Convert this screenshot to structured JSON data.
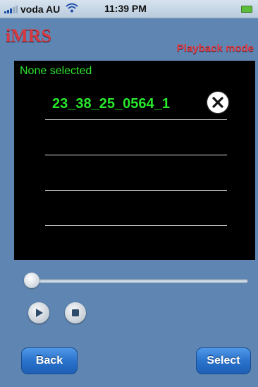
{
  "status_bar": {
    "carrier": "voda AU",
    "time": "11:39 PM"
  },
  "header": {
    "app_title": "iMRS",
    "mode": "Playback mode"
  },
  "list": {
    "selection_status": "None selected",
    "items": [
      {
        "label": "23_38_25_0564_1",
        "removable": true
      },
      {
        "label": "",
        "removable": false
      },
      {
        "label": "",
        "removable": false
      },
      {
        "label": "",
        "removable": false
      }
    ]
  },
  "playback": {
    "position_fraction": 0.0
  },
  "footer": {
    "back_label": "Back",
    "select_label": "Select"
  },
  "colors": {
    "background": "#5f86b2",
    "list_text": "#29e62c",
    "title": "#d73a40",
    "button": "#2a73cc"
  }
}
